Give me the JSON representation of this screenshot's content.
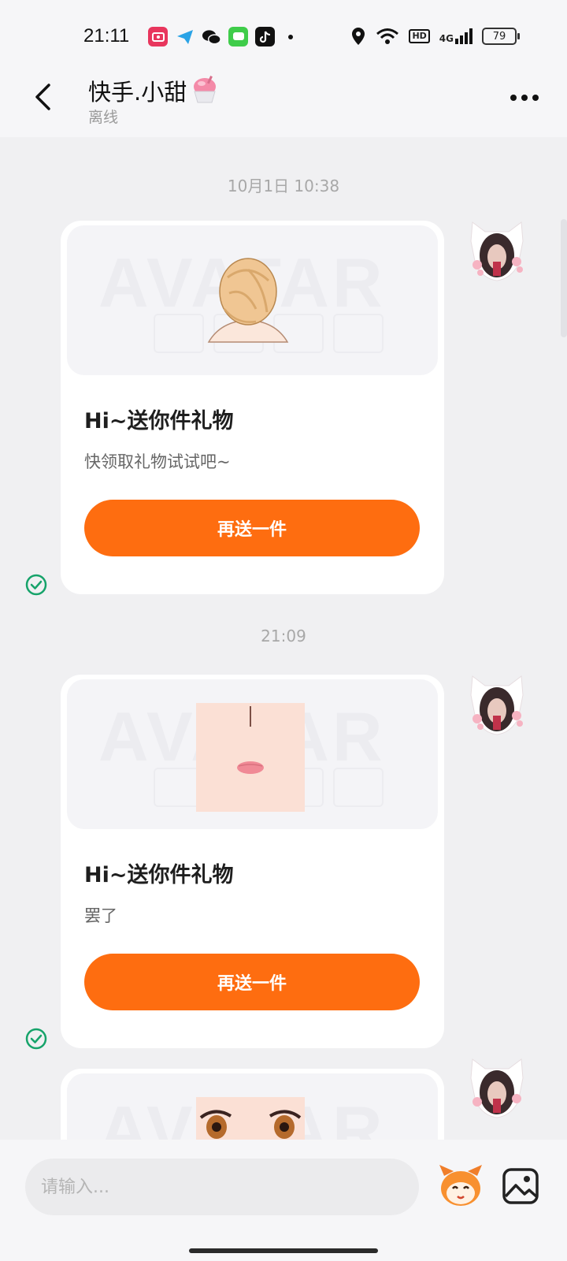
{
  "status_bar": {
    "time": "21:11",
    "app_icons": [
      "video-recorder-icon",
      "telegram-icon",
      "wechat-icon",
      "messages-icon",
      "tiktok-icon"
    ],
    "network_label": "4G",
    "hd_label": "HD",
    "battery": "79"
  },
  "header": {
    "contact_name": "快手.小甜",
    "contact_status": "离线",
    "back_icon": "back-arrow-icon",
    "more_icon": "more-dots-icon"
  },
  "messages": [
    {
      "timestamp": "10月1日 10:38",
      "title": "Hi~送你件礼物",
      "subtitle": "快领取礼物试试吧~",
      "button_label": "再送一件",
      "gift_image": "avatar-hair-item",
      "status_icon": "sent-check-icon"
    },
    {
      "timestamp": "21:09",
      "title": "Hi~送你件礼物",
      "subtitle": "罢了",
      "button_label": "再送一件",
      "gift_image": "avatar-face-item",
      "status_icon": "sent-check-icon"
    },
    {
      "gift_image": "avatar-eyes-item"
    }
  ],
  "input_bar": {
    "placeholder": "请输入...",
    "sticker_icon": "sticker-mascot-icon",
    "image_icon": "image-picker-icon"
  },
  "colors": {
    "accent": "#fe6d10",
    "check": "#16a36a",
    "background": "#f0f0f2"
  }
}
